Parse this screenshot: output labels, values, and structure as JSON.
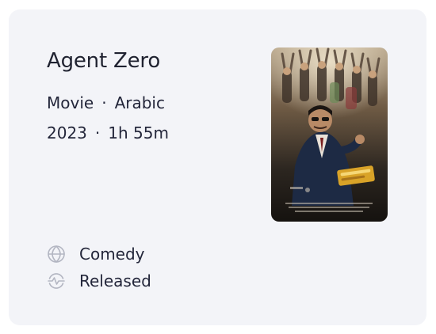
{
  "title": "Agent Zero",
  "meta": {
    "type": "Movie",
    "language": "Arabic",
    "year": "2023",
    "runtime": "1h 55m",
    "separator": "·"
  },
  "poster": {
    "icon": "movie-poster-image"
  },
  "details": {
    "genre": {
      "label": "Comedy",
      "icon": "globe-icon"
    },
    "status": {
      "label": "Released",
      "icon": "activity-icon"
    }
  },
  "colors": {
    "card_background": "#f3f4f8",
    "text": "#1f2230",
    "icon": "#b3b6c2"
  }
}
